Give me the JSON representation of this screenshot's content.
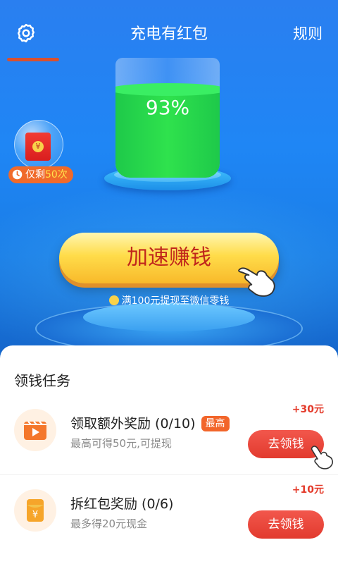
{
  "header": {
    "title": "充电有红包",
    "rules_label": "规则",
    "settings_icon": "gear-icon"
  },
  "battery": {
    "percent_text": "93%",
    "level": 0.93
  },
  "red_packet": {
    "coin_symbol": "¥",
    "chance_prefix": "仅剩",
    "chance_count": "50次"
  },
  "speed": {
    "button_label": "加速赚钱",
    "withdraw_text": "满100元提现至微信零钱"
  },
  "tasks": {
    "section_title": "领钱任务",
    "items": [
      {
        "title": "领取额外奖励 (0/10)",
        "badge": "最高",
        "desc": "最高可得50元,可提现",
        "reward": "+30元",
        "action": "去领钱",
        "icon": "video-play-icon"
      },
      {
        "title": "拆红包奖励 (0/6)",
        "desc": "最多得20元现金",
        "reward": "+10元",
        "action": "去领钱",
        "icon": "red-envelope-icon",
        "icon_symbol": "¥"
      }
    ]
  },
  "colors": {
    "hero_blue": "#1f86f5",
    "accent_red": "#e23a2e",
    "badge_orange": "#f2652a",
    "battery_green": "#2fe24d",
    "button_yellow": "#ffdc4a"
  }
}
